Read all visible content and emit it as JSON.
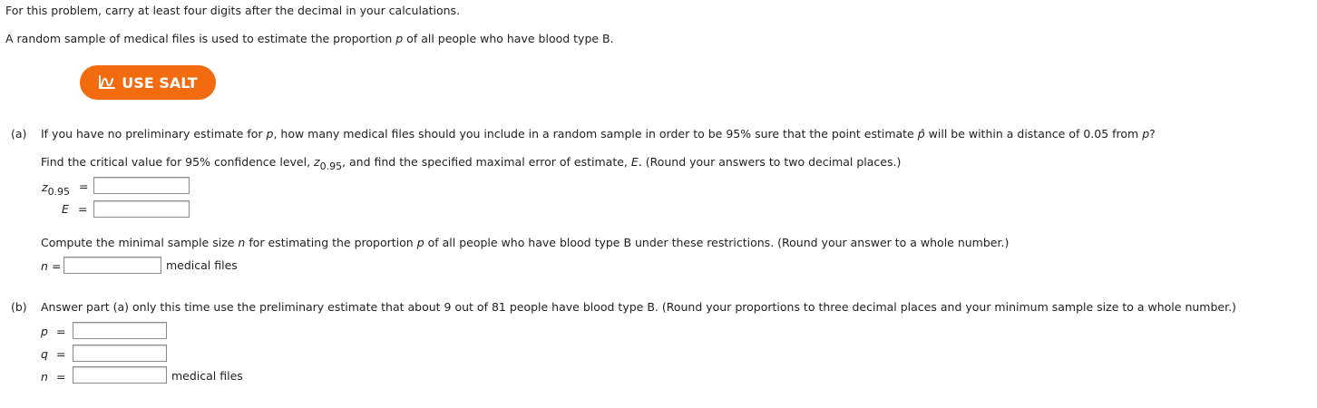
{
  "intro": {
    "line1": "For this problem, carry at least four digits after the decimal in your calculations.",
    "line2_before": "A random sample of medical files is used to estimate the proportion ",
    "line2_var": "p",
    "line2_after": " of all people who have blood type B."
  },
  "salt_button": {
    "label": "USE SALT",
    "icon": "salt-icon",
    "color": "#f26b0f"
  },
  "part_a": {
    "label": "(a)",
    "question_1": "If you have no preliminary estimate for ",
    "question_var_p": "p",
    "question_2": ", how many medical files should you include in a random sample in order to be 95% sure that the point estimate ",
    "question_var_phat": "p̂",
    "question_3": " will be within a distance of 0.05 from ",
    "question_var_p2": "p",
    "question_4": "?",
    "instruction_1": "Find the critical value for 95% confidence level, ",
    "instruction_z": "z",
    "instruction_z_sub": "0.95",
    "instruction_2": ", and find the specified maximal error of estimate, ",
    "instruction_E": "E",
    "instruction_3": ". (Round your answers to two decimal places.)",
    "z_label": "z",
    "z_sub": "0.95",
    "z_eq": "=",
    "z_value": "",
    "E_label": "E",
    "E_eq": "=",
    "E_value": "",
    "compute_1": "Compute the minimal sample size ",
    "compute_n": "n",
    "compute_2": " for estimating the proportion ",
    "compute_p": "p",
    "compute_3": " of all people who have blood type B under these restrictions. (Round your answer to a whole number.)",
    "n_label": "n",
    "n_eq": "=",
    "n_value": "",
    "n_unit": "medical files"
  },
  "part_b": {
    "label": "(b)",
    "question": "Answer part (a) only this time use the preliminary estimate that about 9 out of 81 people have blood type B. (Round your proportions to three decimal places and your minimum sample size to a whole number.)",
    "p_label": "p",
    "p_eq": "=",
    "p_value": "",
    "q_label": "q",
    "q_eq": "=",
    "q_value": "",
    "n_label": "n",
    "n_eq": "=",
    "n_value": "",
    "n_unit": "medical files"
  }
}
